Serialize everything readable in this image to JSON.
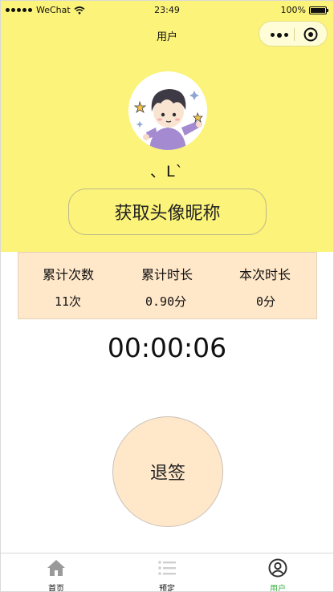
{
  "status_bar": {
    "carrier": "WeChat",
    "time": "23:49",
    "battery": "100%"
  },
  "nav": {
    "title": "用户"
  },
  "profile": {
    "nickname": "、L`",
    "get_profile_button": "获取头像昵称"
  },
  "stats": [
    {
      "label": "累计次数",
      "value": "11次"
    },
    {
      "label": "累计时长",
      "value": "0.90分"
    },
    {
      "label": "本次时长",
      "value": "0分"
    }
  ],
  "timer": "00:00:06",
  "checkout_button": "退签",
  "tabbar": {
    "items": [
      {
        "label": "首页",
        "icon": "home-icon",
        "active": false
      },
      {
        "label": "预定",
        "icon": "list-icon",
        "active": false
      },
      {
        "label": "用户",
        "icon": "user-icon",
        "active": true
      }
    ],
    "active_color": "#3cb043"
  },
  "colors": {
    "header_bg": "#fbf37a",
    "stats_bg": "#ffe7c9",
    "checkout_bg": "#ffe7c9"
  }
}
